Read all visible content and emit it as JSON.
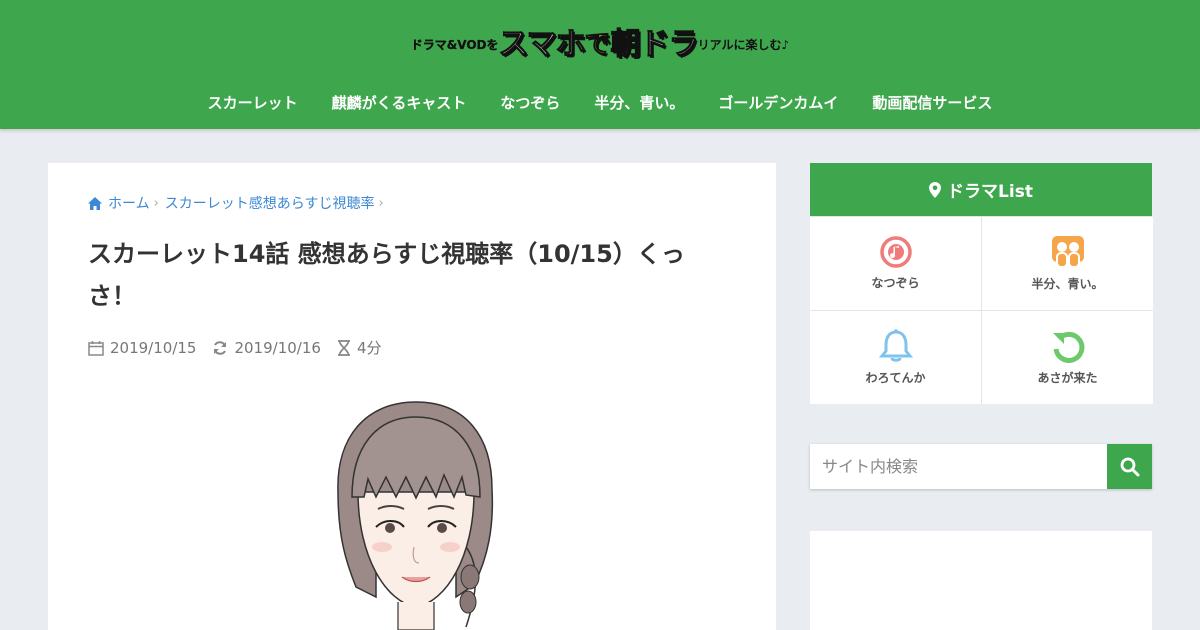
{
  "site": {
    "logo": {
      "part1": "ドラマ&VODを",
      "part2": "スマホ",
      "part3": "で",
      "part4": "朝ドラ",
      "part5": "リアルに楽しむ♪"
    },
    "nav": [
      "スカーレット",
      "麒麟がくるキャスト",
      "なつぞら",
      "半分、青い。",
      "ゴールデンカムイ",
      "動画配信サービス"
    ],
    "accent_color": "#3ea64d"
  },
  "breadcrumb": {
    "home": "ホーム",
    "category": "スカーレット感想あらすじ視聴率"
  },
  "article": {
    "title": "スカーレット14話 感想あらすじ視聴率（10/15）くっさ！",
    "published": "2019/10/15",
    "updated": "2019/10/16",
    "reading_time": "4分"
  },
  "sidebar": {
    "widget_title": "ドラマList",
    "items": [
      {
        "label": "なつぞら",
        "icon": "music-disc-icon",
        "color": "#f07b7b"
      },
      {
        "label": "半分、青い。",
        "icon": "people-icon",
        "color": "#f5a64a"
      },
      {
        "label": "わろてんか",
        "icon": "bell-icon",
        "color": "#7ec3ee"
      },
      {
        "label": "あさが来た",
        "icon": "refresh-icon",
        "color": "#6cc96c"
      }
    ],
    "search_placeholder": "サイト内検索"
  }
}
